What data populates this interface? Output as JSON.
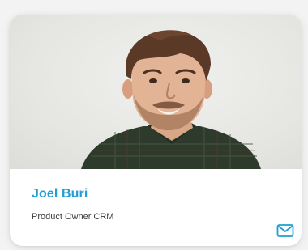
{
  "profile": {
    "name": "Joel Buri",
    "role": "Product Owner CRM",
    "photo_icon": "person-photo",
    "contact_icon": "envelope-icon"
  },
  "colors": {
    "accent": "#1f9fd4",
    "card_bg": "#ffffff",
    "text": "#3c3c3c"
  }
}
